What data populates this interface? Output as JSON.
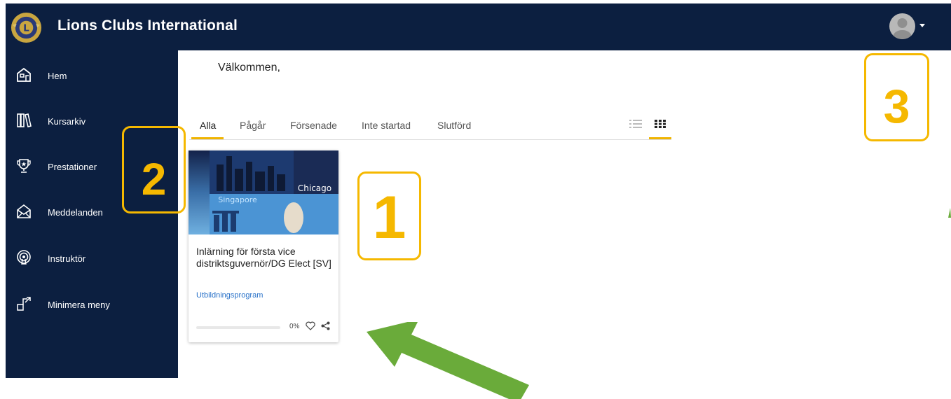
{
  "header": {
    "brand": "Lions Clubs International",
    "logo_icon": "lions-emblem-icon",
    "avatar_icon": "user-avatar-icon",
    "background_color": "#0c1f40"
  },
  "sidebar": {
    "items": [
      {
        "label": "Hem",
        "icon": "home-icon"
      },
      {
        "label": "Kursarkiv",
        "icon": "books-icon"
      },
      {
        "label": "Prestationer",
        "icon": "trophy-icon"
      },
      {
        "label": "Meddelanden",
        "icon": "envelope-icon"
      },
      {
        "label": "Instruktör",
        "icon": "broadcast-icon"
      },
      {
        "label": "Minimera meny",
        "icon": "collapse-menu-icon"
      }
    ]
  },
  "main": {
    "welcome": "Välkommen,",
    "tabs": [
      {
        "label": "Alla",
        "active": true
      },
      {
        "label": "Pågår",
        "active": false
      },
      {
        "label": "Försenade",
        "active": false
      },
      {
        "label": "Inte startad",
        "active": false
      },
      {
        "label": "Slutförd",
        "active": false
      }
    ],
    "views": {
      "list_icon": "list-view-icon",
      "grid_icon": "grid-view-icon",
      "active": "grid"
    },
    "accent_color": "#f0b400",
    "card": {
      "title": "Inlärning för första vice distriktsguvernör/DG Elect [SV]",
      "type": "Utbildningsprogram",
      "image_text_top": "Chicago",
      "image_text_bottom": "Singapore",
      "progress_percent": 0,
      "progress_label": "0%",
      "favorite_icon": "heart-icon",
      "share_icon": "share-icon"
    }
  },
  "annotations": {
    "callouts": [
      "1",
      "2",
      "3"
    ],
    "callout_color": "#f5b800",
    "arrow_color": "#6aab3a"
  }
}
